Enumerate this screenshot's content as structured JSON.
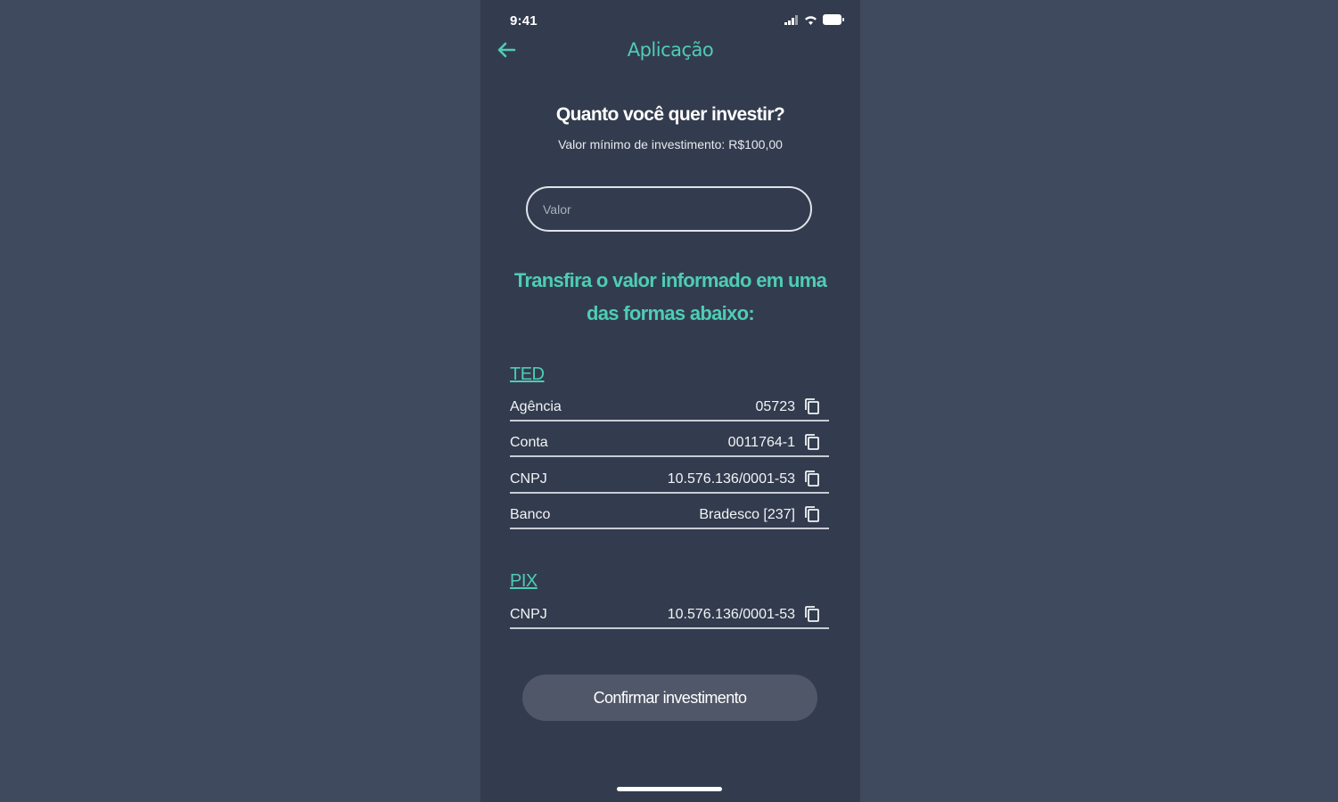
{
  "status_bar": {
    "time": "9:41",
    "icons": [
      "signal-icon",
      "wifi-icon",
      "battery-icon"
    ]
  },
  "header": {
    "title": "Aplicação",
    "back_icon": "arrow-left-icon"
  },
  "investment": {
    "question": "Quanto você quer investir?",
    "min_value": "Valor mínimo de investimento: R$100,00",
    "input_placeholder": "Valor",
    "input_value": ""
  },
  "transfer_instructions": "Transfira o valor informado em uma das formas abaixo:",
  "ted": {
    "title": "TED",
    "rows": [
      {
        "label": "Agência",
        "value": "05723"
      },
      {
        "label": "Conta",
        "value": "0011764-1"
      },
      {
        "label": "CNPJ",
        "value": "10.576.136/0001-53"
      },
      {
        "label": "Banco",
        "value": "Bradesco [237]"
      }
    ]
  },
  "pix": {
    "title": "PIX",
    "rows": [
      {
        "label": "CNPJ",
        "value": "10.576.136/0001-53"
      }
    ]
  },
  "confirm_button": "Confirmar investimento",
  "colors": {
    "background": "#3f4a5e",
    "screen": "#333c4e",
    "accent": "#4ecdb4",
    "button": "#4f5768"
  }
}
